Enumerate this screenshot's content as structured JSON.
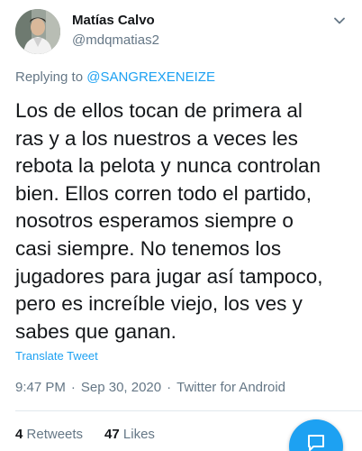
{
  "tweet": {
    "author_name": "Matías Calvo",
    "author_handle": "@mdqmatias2",
    "reply_prefix": "Replying to",
    "reply_mention": "@SANGREXENEIZE",
    "body_lines": [
      "Los de ellos tocan de primera al",
      "ras y a los nuestros a veces les",
      "rebota la pelota y nunca controlan",
      "bien. Ellos corren todo el partido,",
      "nosotros esperamos siempre o",
      "casi siempre. No tenemos los",
      "jugadores para jugar así tampoco,",
      "pero es increíble viejo, los ves y",
      "sabes que ganan."
    ],
    "translate_label": "Translate Tweet",
    "time": "9:47 PM",
    "date": "Sep 30, 2020",
    "source": "Twitter for Android",
    "separator": "·",
    "retweets_count": "4",
    "retweets_label": "Retweets",
    "likes_count": "47",
    "likes_label": "Likes"
  },
  "icons": {
    "menu": "chevron-down-icon",
    "fab": "compose-icon"
  },
  "colors": {
    "accent": "#1da1f2",
    "text": "#14171a",
    "secondary": "#657786",
    "divider": "#e1e8ed"
  }
}
